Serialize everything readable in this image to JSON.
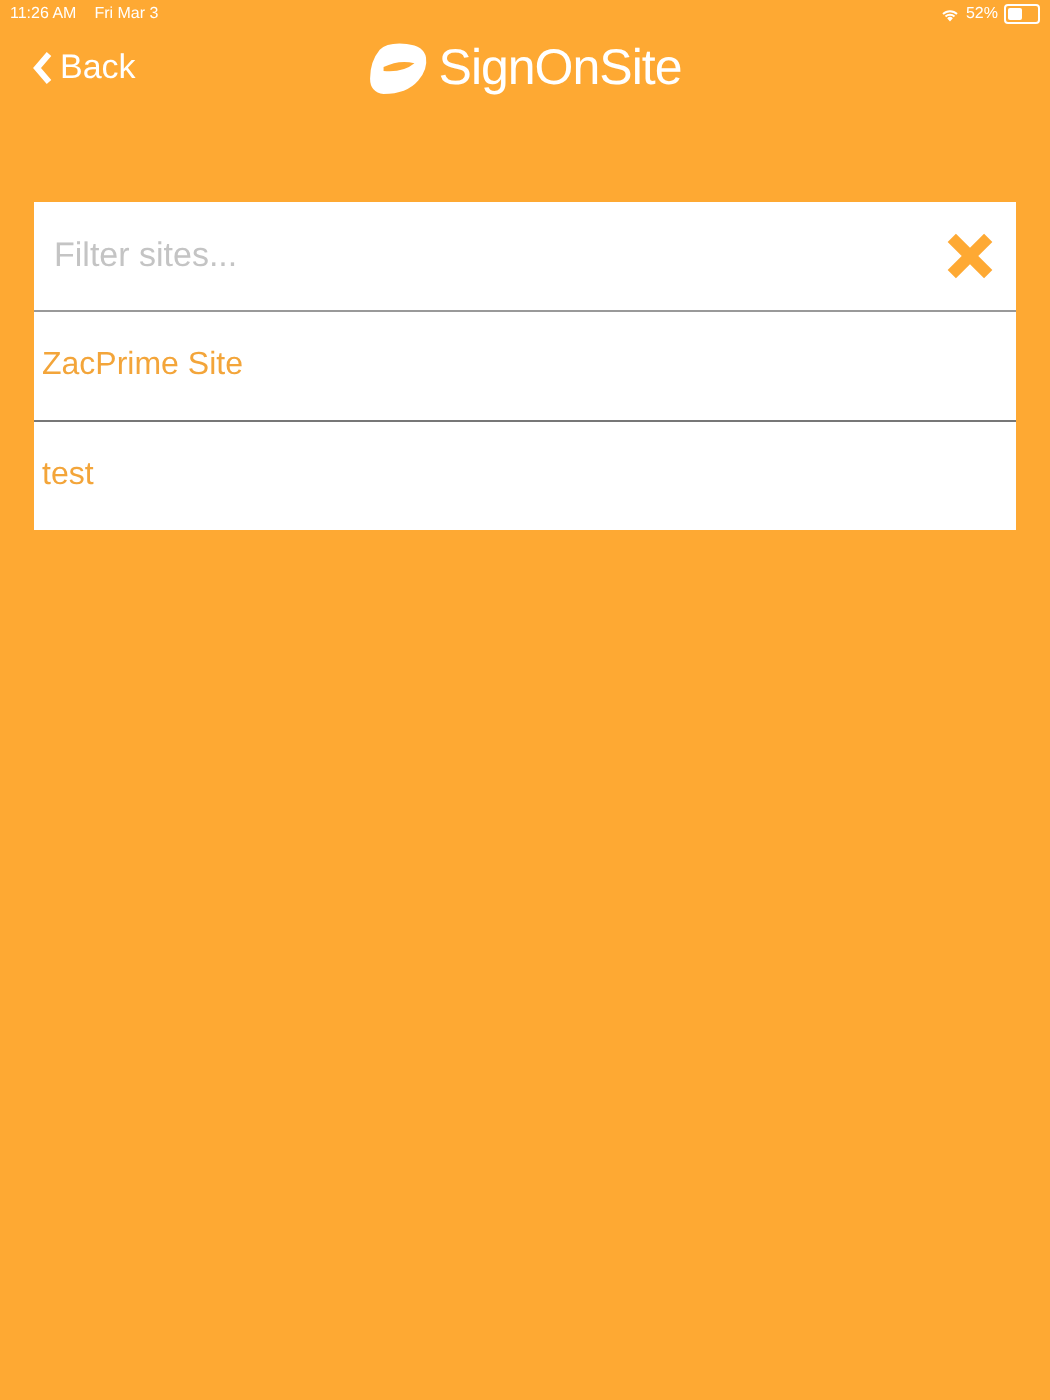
{
  "status_bar": {
    "time": "11:26 AM",
    "date": "Fri Mar 3",
    "battery": "52%"
  },
  "nav": {
    "back": "Back",
    "logo": "SignOnSite"
  },
  "search": {
    "placeholder": "Filter sites..."
  },
  "sites": [
    {
      "name": "ZacPrime Site"
    },
    {
      "name": "test"
    }
  ]
}
